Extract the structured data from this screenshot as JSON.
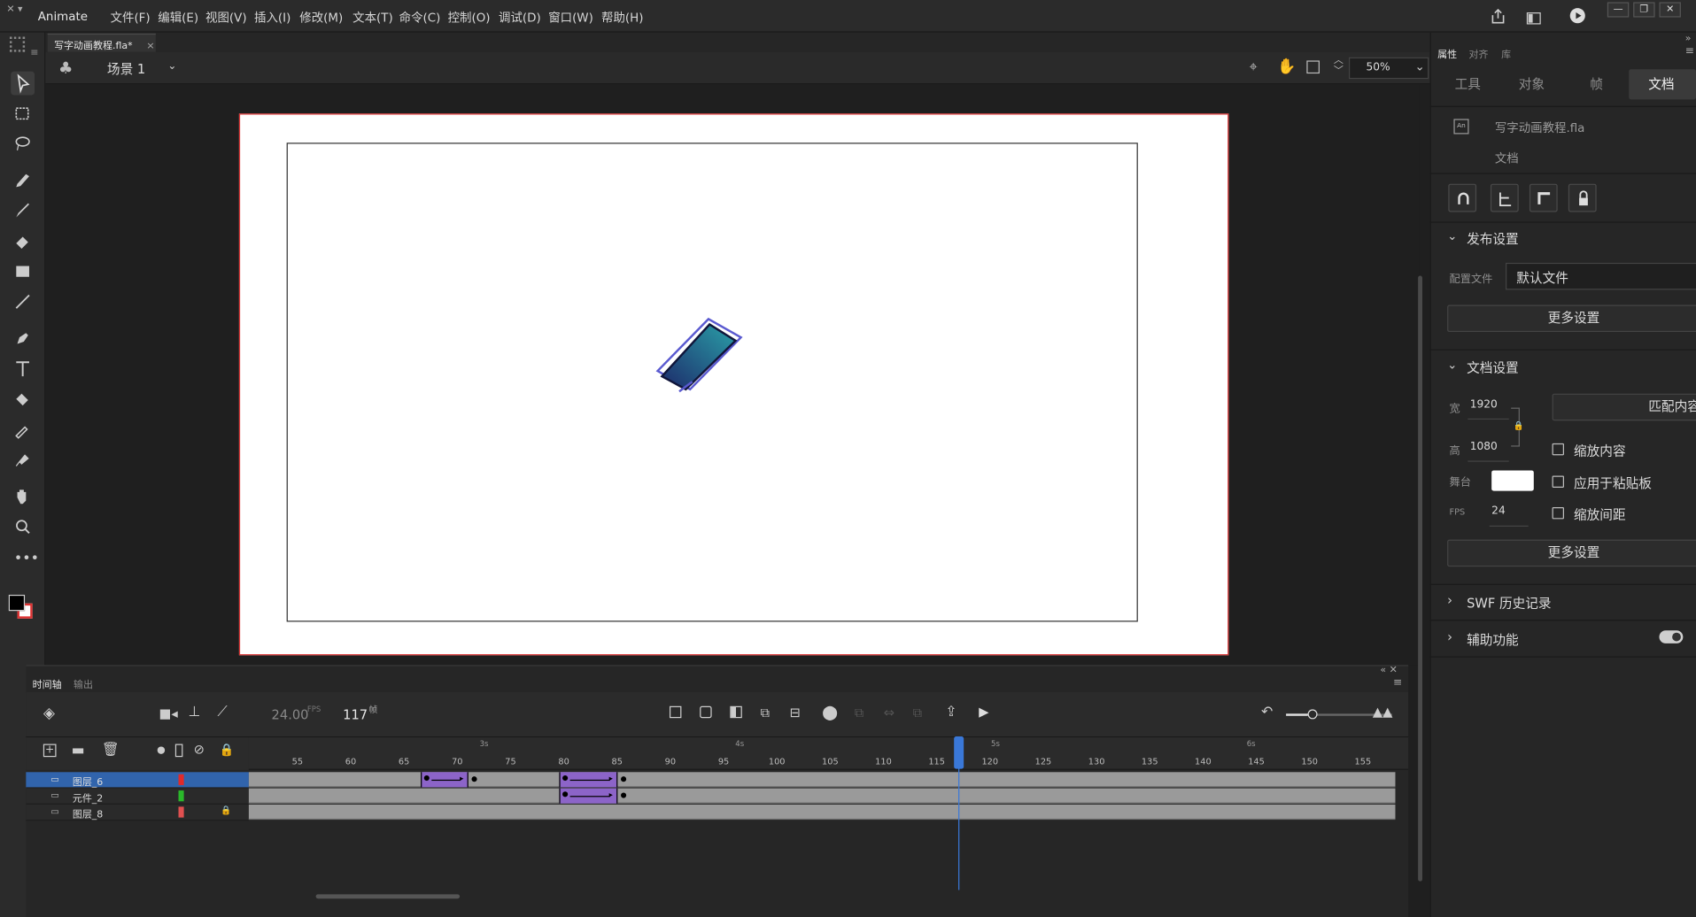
{
  "app": {
    "name": "Animate"
  },
  "menu": [
    "文件(F)",
    "编辑(E)",
    "视图(V)",
    "插入(I)",
    "修改(M)",
    "文本(T)",
    "命令(C)",
    "控制(O)",
    "调试(D)",
    "窗口(W)",
    "帮助(H)"
  ],
  "document_tab": {
    "label": "写字动画教程.fla*",
    "close": "×"
  },
  "editbar": {
    "scene": "场景 1",
    "zoom": "50%"
  },
  "timeline": {
    "tabs": [
      "时间轴",
      "输出"
    ],
    "fps": "24.00",
    "fps_unit": "FPS",
    "current_frame": "117",
    "frame_unit": "帧",
    "ruler_ticks": [
      "55",
      "60",
      "65",
      "70",
      "75",
      "80",
      "85",
      "90",
      "95",
      "100",
      "105",
      "110",
      "115",
      "120",
      "125",
      "130",
      "135",
      "140",
      "145",
      "150",
      "155"
    ],
    "seconds": [
      "3s",
      "4s",
      "5s",
      "6s"
    ],
    "playhead_frame": 117,
    "layers": [
      {
        "name": "图层_6",
        "color": "#e02a2a",
        "selected": true,
        "locked": false
      },
      {
        "name": "元件_2",
        "color": "#2ab82a",
        "selected": false,
        "locked": false
      },
      {
        "name": "图层_8",
        "color": "#e05050",
        "selected": false,
        "locked": true
      }
    ],
    "tweens": [
      {
        "layer": 0,
        "start": 67,
        "end": 71
      },
      {
        "layer": 0,
        "start": 80,
        "end": 85
      },
      {
        "layer": 1,
        "start": 80,
        "end": 85
      }
    ]
  },
  "properties": {
    "panel_tabs": [
      "属性",
      "对齐",
      "库"
    ],
    "tabs": [
      "工具",
      "对象",
      "帧",
      "文档"
    ],
    "active_tab": "文档",
    "doc_name": "写字动画教程.fla",
    "doc_type": "文档",
    "publish": {
      "title": "发布设置",
      "profile_label": "配置文件",
      "profile_value": "默认文件",
      "more": "更多设置"
    },
    "doc_settings": {
      "title": "文档设置",
      "width_label": "宽",
      "width": "1920",
      "height_label": "高",
      "height": "1080",
      "match": "匹配内容",
      "stage_label": "舞台",
      "stage_color": "#ffffff",
      "fps_label": "FPS",
      "fps": "24",
      "scale_content": "缩放内容",
      "apply_pasteboard": "应用于粘贴板",
      "scale_spacing": "缩放间距",
      "more": "更多设置"
    },
    "swf_history": "SWF 历史记录",
    "accessibility": "辅助功能"
  },
  "colors": {
    "accent": "#3a78d8",
    "tween": "#8c64c8",
    "stage_border": "#d93030"
  }
}
